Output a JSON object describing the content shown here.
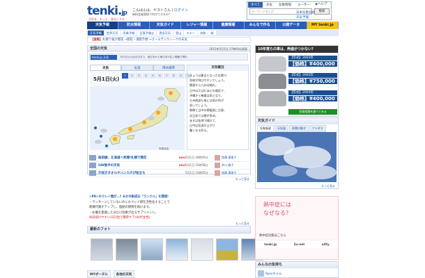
{
  "header": {
    "logo_main": "tenki.",
    "logo_suffix": "jp",
    "tagline": "天気を、もっと、身近にする",
    "greeting": "こんばんは、ゲストさん",
    "logout": "ログイン",
    "service": "無料会員登録で何ができるの？",
    "help": "ヘルプ",
    "search_tabs": [
      "すべて",
      "天気",
      "気象情報",
      "ユーザー"
    ],
    "search_placeholder": "キーワードを入力",
    "search_button": "検索",
    "links1": "日本気象協会",
    "links2": "天気予報"
  },
  "nav": [
    "天気予報",
    "防災情報",
    "天気ガイド",
    "レジャー情報",
    "健康情報",
    "みんなで作る",
    "公開データ",
    "MY tenki.jp"
  ],
  "subnav": [
    "天気予報",
    "世界天気",
    "気象予報",
    "日直予報士",
    "過去天気",
    "登山",
    "スキー",
    "花粉",
    "桜"
  ],
  "news": {
    "badge": "【速報】",
    "text": "札幌で桜が開花",
    "extra": "→開花・満開予想",
    "extra2": "→ゴールデンウィークの天気"
  },
  "panel": {
    "title": "全国の天気",
    "datetime": "2012年5月1日 17時00分発表",
    "yahoo": "tenki.jp 天気",
    "ytext": "5月1日(火)は日中まで、西日本から東日本の広い範囲で晴れ"
  },
  "tabs": [
    "天気",
    "気温",
    "降水確率"
  ],
  "calendar": {
    "day": "5月1日(火)",
    "cells": [
      "1",
      "2",
      "3",
      "4",
      "5",
      "6",
      "7",
      "8",
      "9",
      "10"
    ]
  },
  "mapcap": "気象協会",
  "explanation": {
    "title": "天気概況",
    "lines": [
      "きょうは夏日となった札幌で、",
      "花粉が飛びやすいでしょう。",
      "関東から九州は晴れ。",
      "日中は汗ばむほどの陽気で、",
      "沖縄から奄美は雨となり、",
      "九州南部も夜には雨の所が",
      "多いでしょう。",
      "朝晩と日中の寒暖差に注意、",
      "北日本では雲が多め。",
      "あすは各地で晴れて、",
      "日中は気温が上がり",
      "暑くなる所も。"
    ]
  },
  "vrows": [
    {
      "title": "桜前線、北海道へ到達!札幌で開花",
      "new": "NEW",
      "date": "5月1日 16時45分",
      "author": "相澤 惠理子"
    },
    {
      "title": "GW後半の天気",
      "new": "NEW",
      "date": "5月1日 15時58分",
      "author": "井口 順子"
    },
    {
      "title": "汗拭きタオルやハンカチが役立ち",
      "new": "",
      "date": "5月1日 15時35分",
      "author": "相澤 惠理子"
    }
  ],
  "more1": "もっと見る",
  "pr": {
    "label": "<PR>",
    "title": "ホクレイ燃が…? みかの新成分「ランクル」を開発!",
    "l1": "・マッサージしていないのにホクレイ燃を活性化することで",
    "l2": "  新陳代謝がアップし、脂肪の燃焼を助けます。",
    "l3": "・お腹を意識した分だけ効果が出るサプリメント。",
    "l4": "  毎日続けやすい1日1粒で簡単ケア(40代女性)"
  },
  "more2": "もっと見る",
  "photo_title": "最新のフォト",
  "bottom": [
    "MYポータル",
    "各地の天気"
  ],
  "ad": {
    "title": "10年落ちの車は、売値がつかない?",
    "cars": [
      {
        "year": "【年式】2003年",
        "price": "【価格】¥400,000"
      },
      {
        "year": "【年式】2003年",
        "price": "【価格】¥750,000"
      },
      {
        "year": "【年式】2003年",
        "price": "【価格】¥400,000"
      }
    ],
    "cta": "売値相場を調べてみる"
  },
  "guide": {
    "title": "天気ガイド",
    "tabs": [
      "気象衛星",
      "天気図",
      "雨雲の動き",
      "アメダス"
    ],
    "more": "もっと見る"
  },
  "ad2": {
    "l1": "熱中症には",
    "l2": "なぜなる?",
    "link": "熱中症対策はこちら",
    "sponsors": [
      "tenki.jp",
      "So-net",
      "nifty"
    ]
  },
  "voice": {
    "title": "みんなの気持ち",
    "name": "Ryouちゃん"
  }
}
